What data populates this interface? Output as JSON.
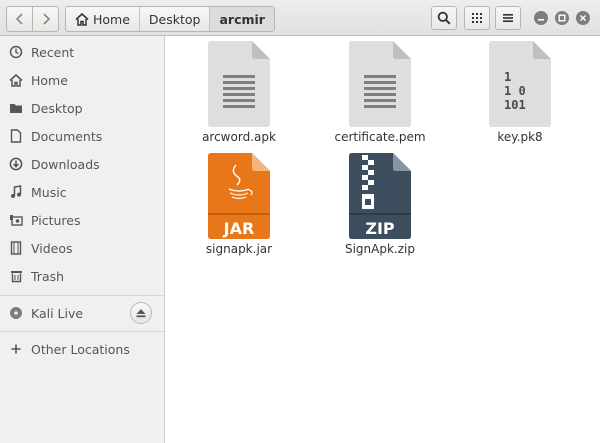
{
  "nav": {
    "back_icon": "chevron-left-icon",
    "forward_icon": "chevron-right-icon"
  },
  "breadcrumb": [
    {
      "label": "Home",
      "icon": "home-icon"
    },
    {
      "label": "Desktop"
    },
    {
      "label": "arcmir"
    }
  ],
  "toolbar": {
    "search_icon": "search-icon",
    "view_icon": "grid-view-icon",
    "menu_icon": "hamburger-menu-icon"
  },
  "window_controls": [
    "minimize-icon",
    "maximize-icon",
    "close-icon"
  ],
  "sidebar": {
    "places": [
      {
        "label": "Recent",
        "icon": "clock-icon"
      },
      {
        "label": "Home",
        "icon": "home-icon"
      },
      {
        "label": "Desktop",
        "icon": "folder-icon"
      },
      {
        "label": "Documents",
        "icon": "document-icon"
      },
      {
        "label": "Downloads",
        "icon": "download-icon"
      },
      {
        "label": "Music",
        "icon": "music-note-icon"
      },
      {
        "label": "Pictures",
        "icon": "camera-icon"
      },
      {
        "label": "Videos",
        "icon": "film-icon"
      },
      {
        "label": "Trash",
        "icon": "trash-icon"
      }
    ],
    "devices": [
      {
        "label": "Kali Live",
        "icon": "disc-icon",
        "action_icon": "eject-icon"
      }
    ],
    "other": {
      "label": "Other Locations",
      "icon": "plus-icon"
    }
  },
  "files": [
    {
      "name": "arcword.apk",
      "icon": "text-file-icon"
    },
    {
      "name": "certificate.pem",
      "icon": "text-file-icon"
    },
    {
      "name": "key.pk8",
      "icon": "binary-file-icon"
    },
    {
      "name": "signapk.jar",
      "icon": "java-jar-icon",
      "badge": "JAR"
    },
    {
      "name": "SignApk.zip",
      "icon": "zip-archive-icon",
      "badge": "ZIP"
    }
  ],
  "colors": {
    "jar_orange": "#e8771a",
    "zip_slate": "#3c4e5e",
    "generic_file": "#d9d9d9"
  }
}
